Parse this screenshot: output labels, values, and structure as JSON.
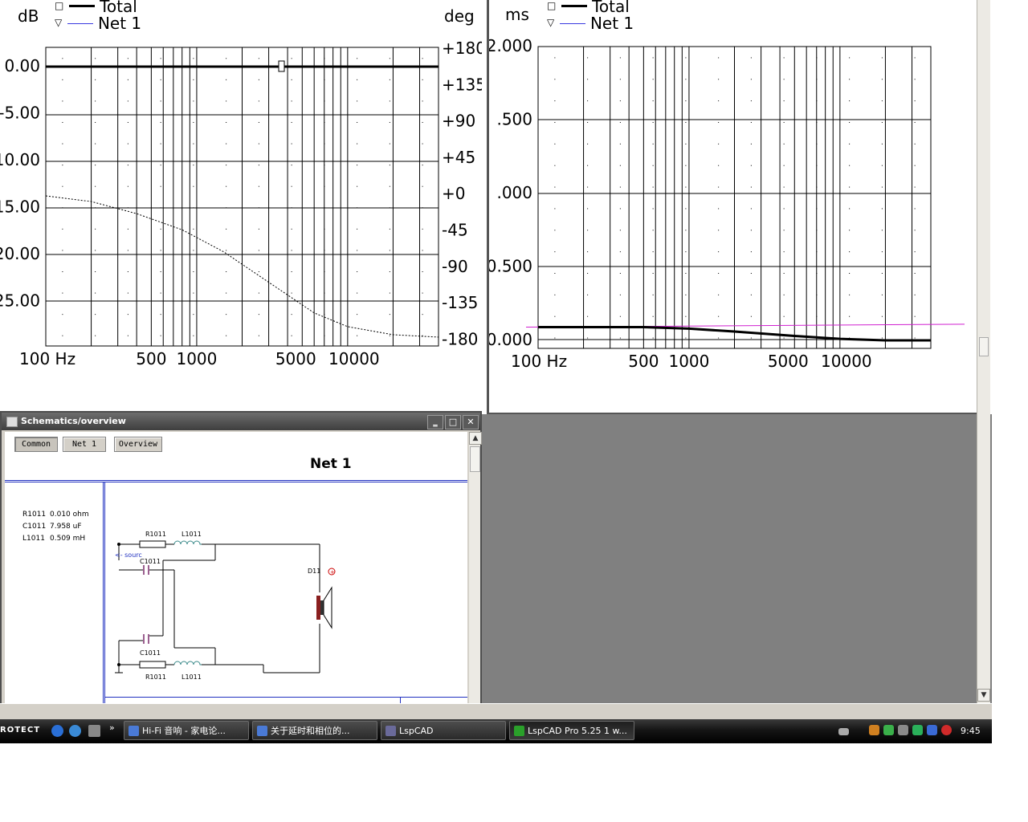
{
  "phase_chart": {
    "left_unit": "dB",
    "right_unit": "deg",
    "legend": [
      {
        "name": "Total",
        "marker": "□",
        "color": "#000000"
      },
      {
        "name": "Net 1",
        "marker": "▽",
        "color": "#3a3ae0"
      }
    ],
    "left_ticks": [
      "0.00",
      "-5.00",
      "10.00",
      "15.00",
      "20.00",
      "25.00"
    ],
    "right_ticks": [
      "+180",
      "+135",
      "+90",
      "+45",
      "+0",
      "-45",
      "-90",
      "-135",
      "-180"
    ],
    "x_ticks": [
      "100 Hz",
      "500",
      "1000",
      "5000",
      "10000"
    ]
  },
  "group_delay_chart": {
    "left_unit": "ms",
    "legend": [
      {
        "name": "Total",
        "marker": "□",
        "color": "#000000"
      },
      {
        "name": "Net 1",
        "marker": "▽",
        "color": "#3a3ae0"
      }
    ],
    "left_ticks": [
      "2.000",
      ".500",
      ".000",
      "0.500",
      "0.000"
    ],
    "x_ticks": [
      "100 Hz",
      "500",
      "1000",
      "5000",
      "10000"
    ]
  },
  "chart_data": [
    {
      "type": "line",
      "xscale": "log",
      "xlim": [
        100,
        40000
      ],
      "ylim_left": [
        -30,
        2
      ],
      "ylim_right": [
        -180,
        180
      ],
      "series": [
        {
          "name": "Total",
          "axis": "left",
          "x": [
            100,
            40000
          ],
          "y": [
            0,
            0
          ]
        },
        {
          "name": "Net 1",
          "axis": "right",
          "x": [
            100,
            200,
            400,
            800,
            1500,
            3000,
            6000,
            10000,
            20000,
            40000
          ],
          "y": [
            -3,
            -10,
            -25,
            -45,
            -72,
            -110,
            -148,
            -165,
            -175,
            -178
          ]
        }
      ],
      "grid": true
    },
    {
      "type": "line",
      "xscale": "log",
      "xlim": [
        100,
        40000
      ],
      "ylim": [
        0,
        2
      ],
      "series": [
        {
          "name": "Total",
          "x": [
            100,
            500,
            1000,
            2000,
            5000,
            10000,
            20000,
            40000
          ],
          "y": [
            0.09,
            0.09,
            0.08,
            0.06,
            0.03,
            0.01,
            0.0,
            0.0
          ]
        },
        {
          "name": "Net 1",
          "x": [
            90,
            50000
          ],
          "y": [
            0.09,
            0.11
          ]
        }
      ],
      "grid": true
    }
  ],
  "schematic": {
    "title": "Schematics/overview",
    "tabs": [
      "Common",
      "Net 1",
      "Overview"
    ],
    "heading": "Net 1",
    "parts": [
      {
        "ref": "R1011",
        "value": "0.010 ohm"
      },
      {
        "ref": "C1011",
        "value": "7.958 uF"
      },
      {
        "ref": "L1011",
        "value": "0.509 mH"
      }
    ],
    "labels": {
      "r_top": "R1011",
      "l_top": "L1011",
      "c_top": "C1011",
      "source": "<- sourc",
      "driver": "D11",
      "c_bot": "C1011",
      "r_bot": "R1011",
      "l_bot": "L1011"
    }
  },
  "taskbar": {
    "protect_text": "ROTECT",
    "tasks": [
      "Hi-Fi 音响 - 家电论...",
      "关于延时和相位的...",
      "LspCAD",
      "LspCAD Pro 5.25 1 w..."
    ],
    "clock": "9:45"
  }
}
